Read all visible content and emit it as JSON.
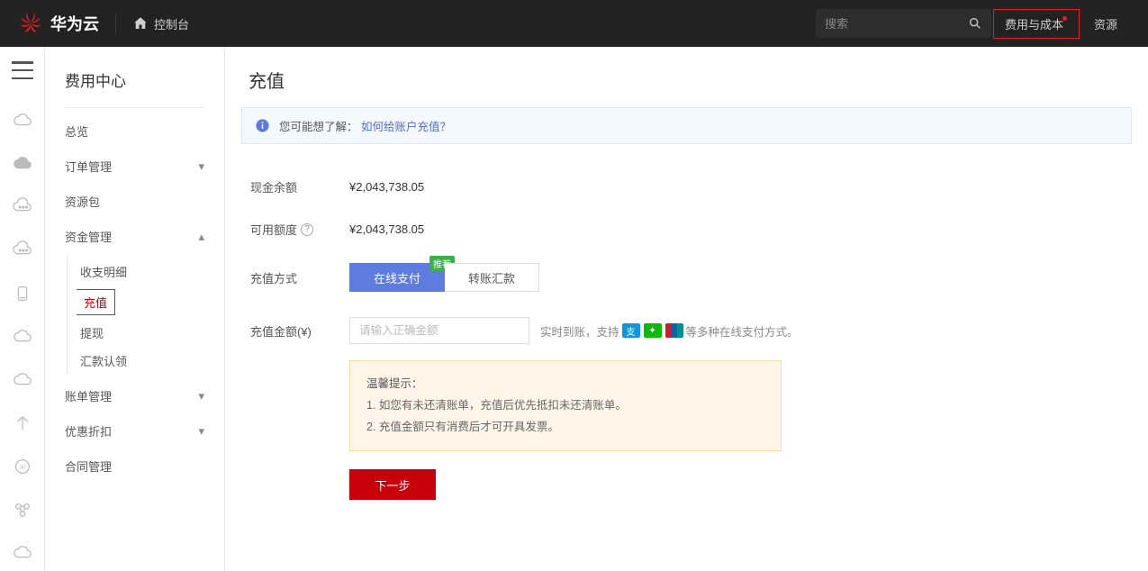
{
  "header": {
    "brand": "华为云",
    "console": "控制台",
    "search_placeholder": "搜索",
    "cost_link": "费用与成本",
    "resource_link": "资源"
  },
  "sidebar": {
    "title": "费用中心",
    "items": [
      {
        "label": "总览",
        "expandable": false
      },
      {
        "label": "订单管理",
        "expandable": true,
        "open": false
      },
      {
        "label": "资源包",
        "expandable": false
      },
      {
        "label": "资金管理",
        "expandable": true,
        "open": true,
        "sub": [
          {
            "label": "收支明细",
            "active": false
          },
          {
            "label": "充值",
            "active": true
          },
          {
            "label": "提现",
            "active": false
          },
          {
            "label": "汇款认领",
            "active": false
          }
        ]
      },
      {
        "label": "账单管理",
        "expandable": true,
        "open": false
      },
      {
        "label": "优惠折扣",
        "expandable": true,
        "open": false
      },
      {
        "label": "合同管理",
        "expandable": false
      }
    ]
  },
  "main": {
    "title": "充值",
    "info_prefix": "您可能想了解：",
    "info_link": "如何给账户充值？",
    "cash_label": "现金余额",
    "cash_value": "¥2,043,738.05",
    "quota_label": "可用额度",
    "quota_value": "¥2,043,738.05",
    "method_label": "充值方式",
    "methods": [
      "在线支付",
      "转账汇款"
    ],
    "recommend_badge": "推荐",
    "amount_label": "充值金额(¥)",
    "amount_placeholder": "请输入正确金额",
    "amount_note_prefix": "实时到账，支持",
    "amount_note_suffix": "等多种在线支付方式。",
    "tips_title": "温馨提示：",
    "tips": [
      "1. 如您有未还清账单，充值后优先抵扣未还清账单。",
      "2. 充值金额只有消费后才可开具发票。"
    ],
    "next_btn": "下一步"
  }
}
